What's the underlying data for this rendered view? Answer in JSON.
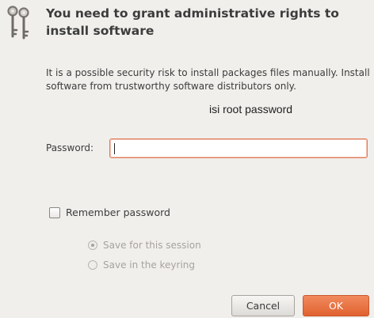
{
  "dialog": {
    "icon": "keys-icon",
    "heading": "You need to grant administrative rights to install software",
    "description": "It is a possible security risk to install packages files manually. Install software from trustworthy software distributors only.",
    "annotation": "isi root password"
  },
  "password": {
    "label": "Password:",
    "value": ""
  },
  "remember": {
    "label": "Remember password",
    "checked": false
  },
  "options": [
    {
      "label": "Save for this session",
      "selected": true,
      "enabled": false
    },
    {
      "label": "Save in the keyring",
      "selected": false,
      "enabled": false
    }
  ],
  "buttons": {
    "cancel": "Cancel",
    "ok": "OK"
  },
  "colors": {
    "background": "#f1efec",
    "accent": "#e0622f",
    "input_border": "#e07b5a"
  }
}
